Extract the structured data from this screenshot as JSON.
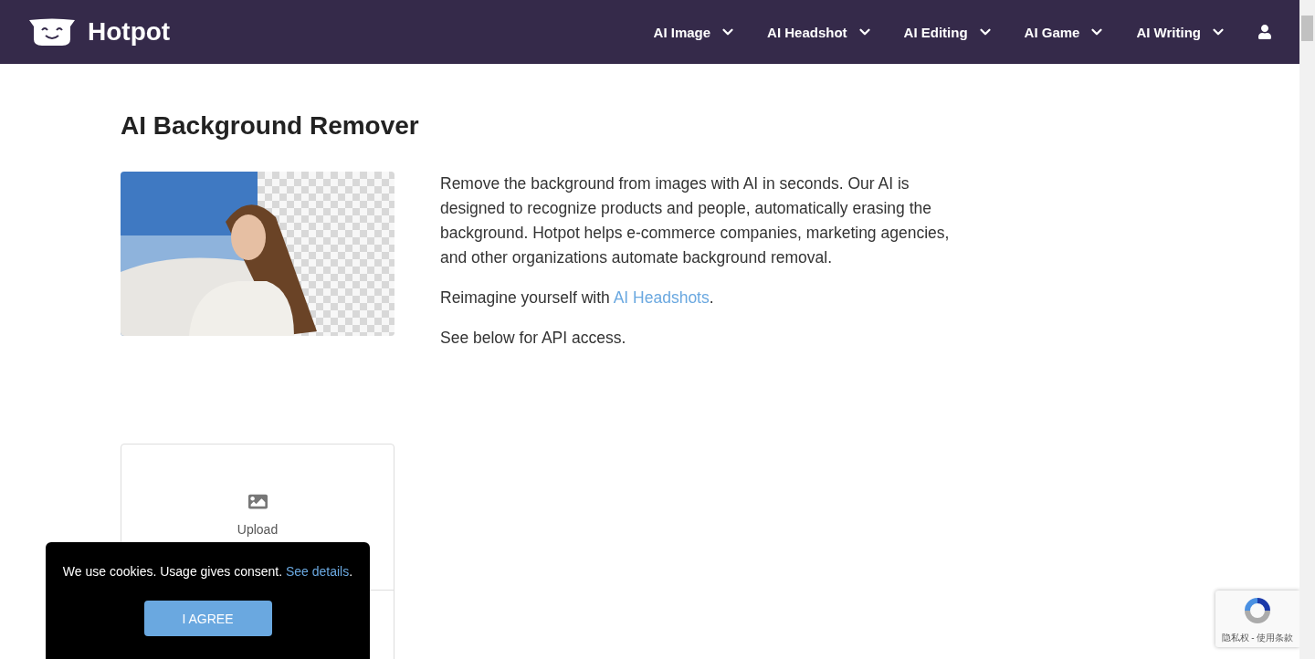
{
  "header": {
    "brand": "Hotpot",
    "nav": [
      {
        "label": "AI Image"
      },
      {
        "label": "AI Headshot"
      },
      {
        "label": "AI Editing"
      },
      {
        "label": "AI Game"
      },
      {
        "label": "AI Writing"
      }
    ]
  },
  "title": "AI Background Remover",
  "intro": {
    "paragraphs": [
      {
        "text": "Remove the background from images with AI in seconds. Our AI is designed to recognize products and people, automatically erasing the background. Hotpot helps e-commerce companies, marketing agencies, and other organizations automate background removal."
      },
      {
        "text": "Reimagine yourself with ",
        "link": "AI Headshots",
        "after": "."
      },
      {
        "text": "See below for API access."
      }
    ]
  },
  "upload": {
    "label": "Upload"
  },
  "cookie_banner": {
    "text": "We use cookies. Usage gives consent. ",
    "link": "See details",
    "after": ".",
    "button": "I AGREE"
  },
  "recaptcha": {
    "links": "隐私权 - 使用条款"
  }
}
